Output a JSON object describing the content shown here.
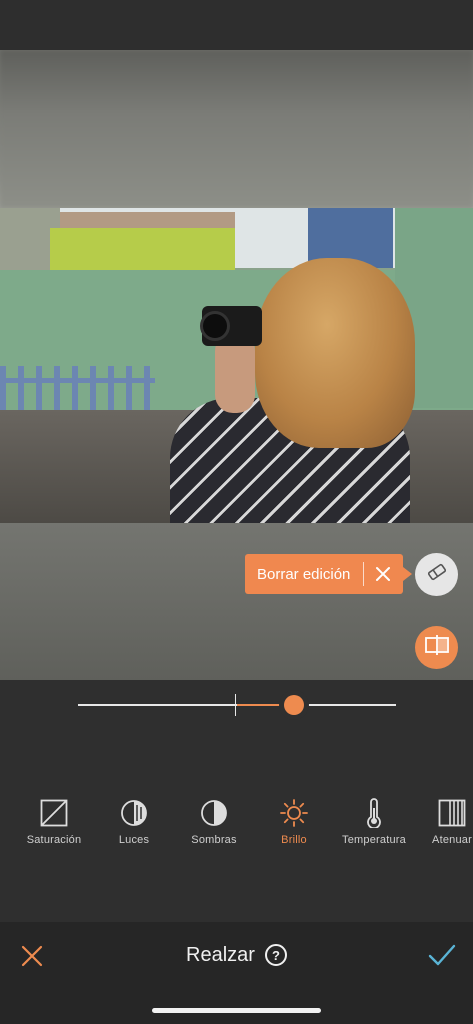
{
  "colors": {
    "accent": "#ee8b4f",
    "bar_bg": "#262626",
    "panel_bg": "#2f2f2f"
  },
  "tooltip": {
    "label": "Borrar edición",
    "close_icon": "close-icon"
  },
  "buttons": {
    "eraser_icon": "eraser-icon",
    "compare_icon": "compare-icon"
  },
  "slider": {
    "value_fraction": 0.68,
    "center_fraction": 0.5
  },
  "tools": [
    {
      "label": "Saturación",
      "icon": "saturation-icon",
      "active": false
    },
    {
      "label": "Luces",
      "icon": "highlights-icon",
      "active": false
    },
    {
      "label": "Sombras",
      "icon": "shadows-icon",
      "active": false
    },
    {
      "label": "Brillo",
      "icon": "brightness-icon",
      "active": true
    },
    {
      "label": "Temperatura",
      "icon": "thermometer-icon",
      "active": false
    },
    {
      "label": "Atenuar",
      "icon": "fade-icon",
      "active": false
    }
  ],
  "bottom_bar": {
    "title": "Realzar",
    "help": "?",
    "cancel_icon": "close-icon",
    "confirm_icon": "checkmark-icon"
  }
}
